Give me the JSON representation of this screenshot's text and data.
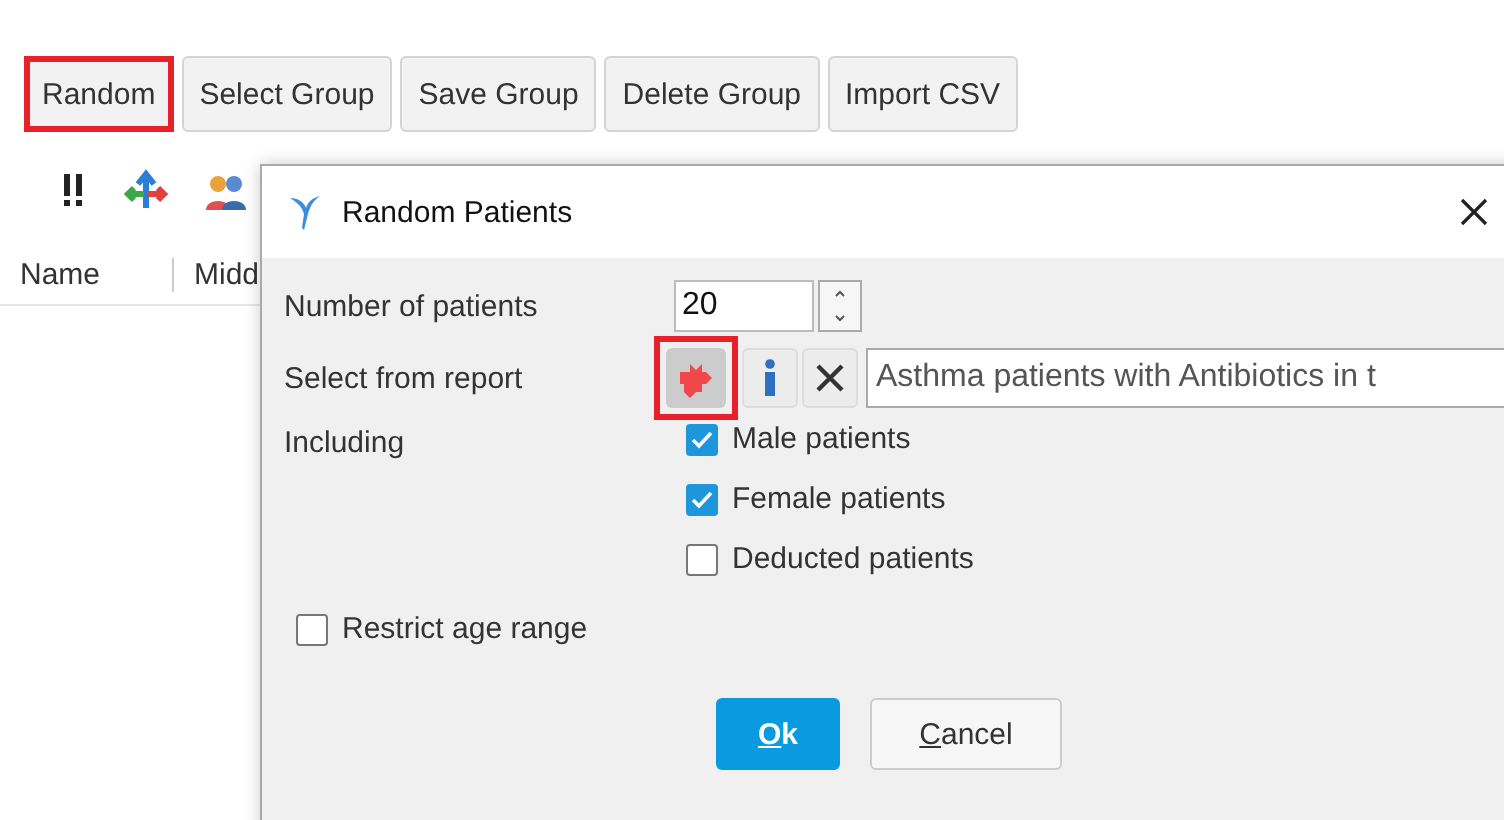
{
  "toolbar": {
    "buttons": [
      {
        "label": "Random",
        "highlighted": true
      },
      {
        "label": "Select Group",
        "highlighted": false
      },
      {
        "label": "Save Group",
        "highlighted": false
      },
      {
        "label": "Delete Group",
        "highlighted": false
      },
      {
        "label": "Import CSV",
        "highlighted": false
      }
    ]
  },
  "table": {
    "columns": [
      "Name",
      "Midd"
    ]
  },
  "dialog": {
    "title": "Random Patients",
    "number_label": "Number of patients",
    "number_value": "20",
    "report_label": "Select from report",
    "report_button_highlighted": true,
    "report_value": "Asthma patients with Antibiotics in t",
    "including_label": "Including",
    "options": [
      {
        "label": "Male patients",
        "checked": true
      },
      {
        "label": "Female patients",
        "checked": true
      },
      {
        "label": "Deducted patients",
        "checked": false
      }
    ],
    "restrict": {
      "label": "Restrict age range",
      "checked": false
    },
    "buttons": [
      {
        "kind": "primary",
        "key": "O",
        "rest": "k"
      },
      {
        "kind": "secondary",
        "key": "C",
        "rest": "ancel"
      }
    ]
  }
}
